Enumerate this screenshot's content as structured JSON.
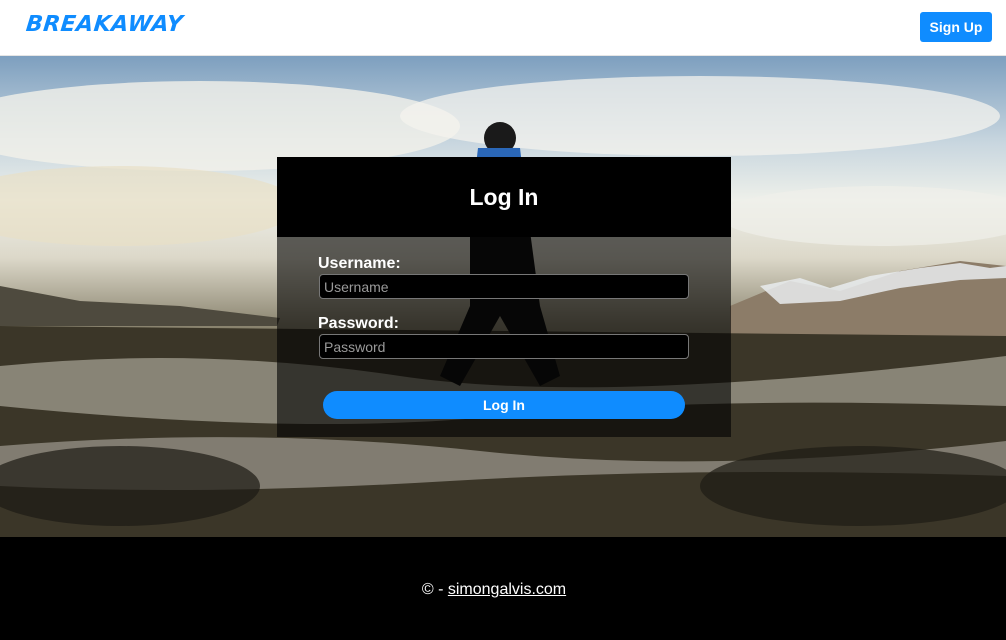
{
  "header": {
    "logo_text": "BREAKAWAY",
    "signup_label": "Sign Up"
  },
  "login": {
    "title": "Log In",
    "username_label": "Username:",
    "username_placeholder": "Username",
    "password_label": "Password:",
    "password_placeholder": "Password",
    "submit_label": "Log In"
  },
  "footer": {
    "copyright_prefix": "© - ",
    "link_text": "simongalvis.com"
  },
  "colors": {
    "accent": "#0f8cff",
    "header_bg": "#ffffff",
    "footer_bg": "#000000"
  }
}
